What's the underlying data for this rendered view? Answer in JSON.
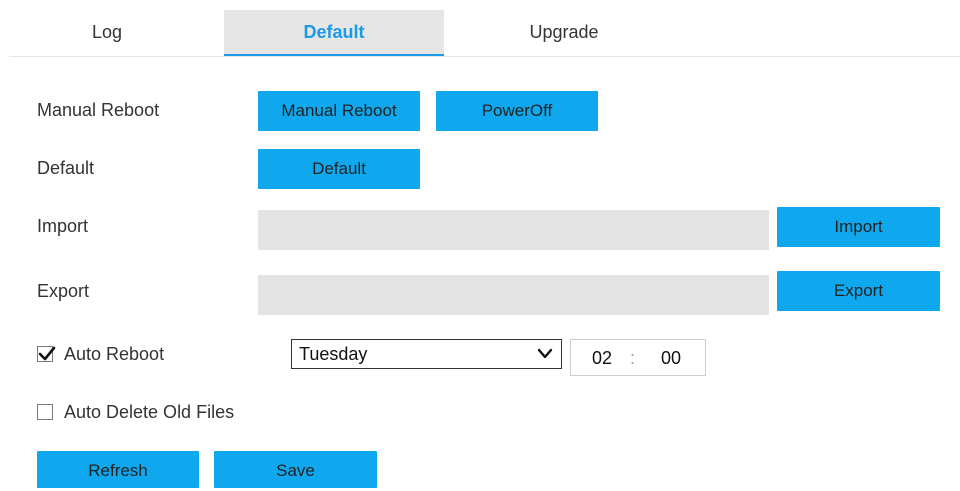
{
  "tabs": [
    {
      "label": "Log",
      "active": false
    },
    {
      "label": "Default",
      "active": true
    },
    {
      "label": "Upgrade",
      "active": false
    }
  ],
  "rows": {
    "manual_reboot": {
      "label": "Manual Reboot",
      "reboot_button": "Manual Reboot",
      "poweroff_button": "PowerOff"
    },
    "default": {
      "label": "Default",
      "button": "Default"
    },
    "import": {
      "label": "Import",
      "value": "",
      "button": "Import"
    },
    "export": {
      "label": "Export",
      "value": "",
      "button": "Export"
    },
    "auto_reboot": {
      "label": "Auto Reboot",
      "checked": true,
      "day": "Tuesday",
      "hour": "02",
      "separator": ":",
      "minute": "00"
    },
    "auto_delete": {
      "label": "Auto Delete Old Files",
      "checked": false
    }
  },
  "footer": {
    "refresh": "Refresh",
    "save": "Save"
  },
  "colors": {
    "accent": "#0fa8ee",
    "active_tab_text": "#1a9be8",
    "active_tab_bg": "#e6e6e6",
    "field_bg": "#e3e3e3"
  }
}
